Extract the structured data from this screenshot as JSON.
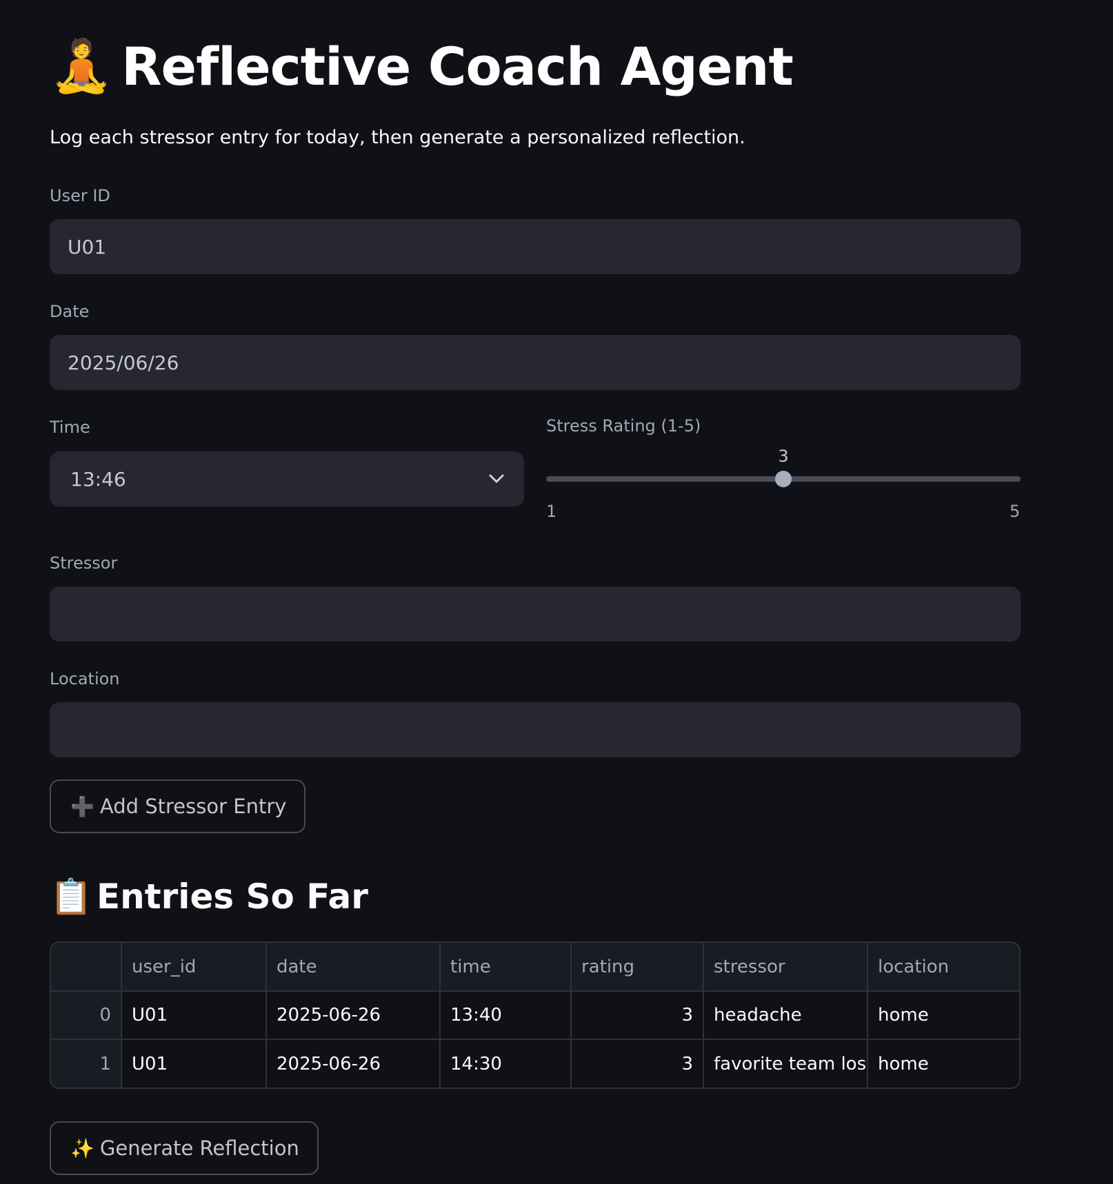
{
  "header": {
    "icon": "🧘",
    "title": "Reflective Coach Agent",
    "subtitle": "Log each stressor entry for today, then generate a personalized reflection."
  },
  "form": {
    "user_id": {
      "label": "User ID",
      "value": "U01"
    },
    "date": {
      "label": "Date",
      "value": "2025/06/26"
    },
    "time": {
      "label": "Time",
      "value": "13:46"
    },
    "stress_rating": {
      "label": "Stress Rating (1-5)",
      "value": 3,
      "min": 1,
      "max": 5
    },
    "stressor": {
      "label": "Stressor",
      "value": ""
    },
    "location": {
      "label": "Location",
      "value": ""
    },
    "add_button": {
      "icon": "➕",
      "label": "Add Stressor Entry"
    }
  },
  "entries": {
    "icon": "📋",
    "title": "Entries So Far",
    "columns": [
      "",
      "user_id",
      "date",
      "time",
      "rating",
      "stressor",
      "location"
    ],
    "rows": [
      {
        "index": "0",
        "user_id": "U01",
        "date": "2025-06-26",
        "time": "13:40",
        "rating": "3",
        "stressor": "headache",
        "location": "home"
      },
      {
        "index": "1",
        "user_id": "U01",
        "date": "2025-06-26",
        "time": "14:30",
        "rating": "3",
        "stressor": "favorite team lost",
        "location": "home"
      }
    ]
  },
  "generate_button": {
    "icon": "✨",
    "label": "Generate Reflection"
  },
  "colors": {
    "background": "#0f1116",
    "input_bg": "#262730",
    "label": "#a3a8b4",
    "slider_thumb": "#a9aebc"
  }
}
